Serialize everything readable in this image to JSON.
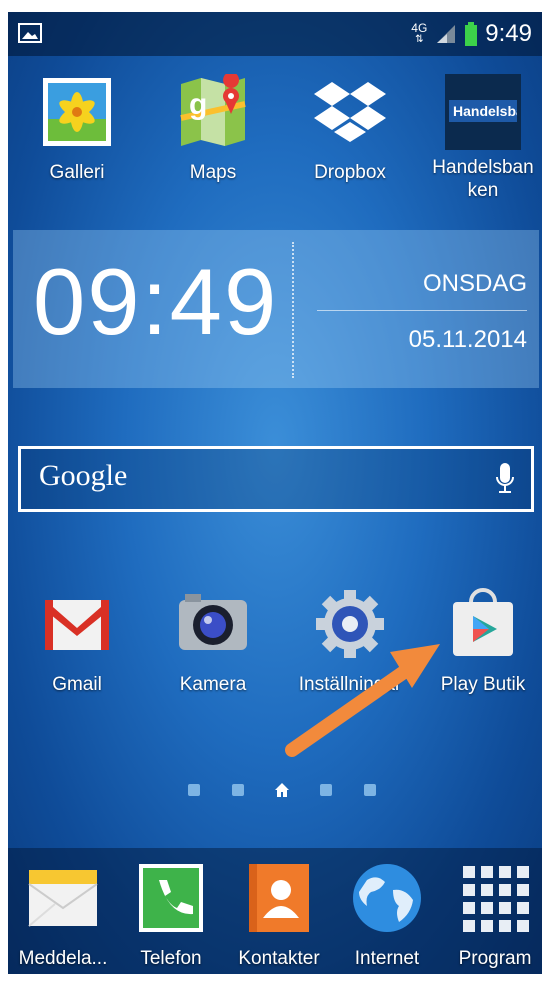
{
  "status_bar": {
    "network": "4G",
    "time": "9:49",
    "left_icon": "gallery-icon",
    "signal_icon": "signal-icon",
    "battery_icon": "battery-icon"
  },
  "home_apps_top": [
    {
      "label": "Galleri",
      "icon": "galleri-icon"
    },
    {
      "label": "Maps",
      "icon": "maps-icon"
    },
    {
      "label": "Dropbox",
      "icon": "dropbox-icon"
    },
    {
      "label": "Handelsban ken",
      "icon": "handelsbanken-icon",
      "icon_text": "Handelsba"
    }
  ],
  "clock_widget": {
    "time": "09:49",
    "day": "ONSDAG",
    "date": "05.11.2014"
  },
  "search": {
    "label": "Google",
    "mic_icon": "mic-icon"
  },
  "home_apps_bottom": [
    {
      "label": "Gmail",
      "icon": "gmail-icon"
    },
    {
      "label": "Kamera",
      "icon": "camera-icon"
    },
    {
      "label": "Inställningar",
      "icon": "settings-icon"
    },
    {
      "label": "Play Butik",
      "icon": "play-store-icon"
    }
  ],
  "page_indicator": {
    "home_icon": "home-icon"
  },
  "dock": [
    {
      "label": "Meddela...",
      "icon": "messages-icon"
    },
    {
      "label": "Telefon",
      "icon": "phone-icon"
    },
    {
      "label": "Kontakter",
      "icon": "contacts-icon"
    },
    {
      "label": "Internet",
      "icon": "internet-icon"
    },
    {
      "label": "Program",
      "icon": "apps-grid-icon"
    }
  ],
  "annotation": {
    "arrow_color": "#f28a3c",
    "arrow_icon": "pointer-arrow"
  },
  "colors": {
    "wallpaper_center": "#3b8ed8",
    "wallpaper_edge": "#0a3c80",
    "battery": "#3cd24a"
  }
}
